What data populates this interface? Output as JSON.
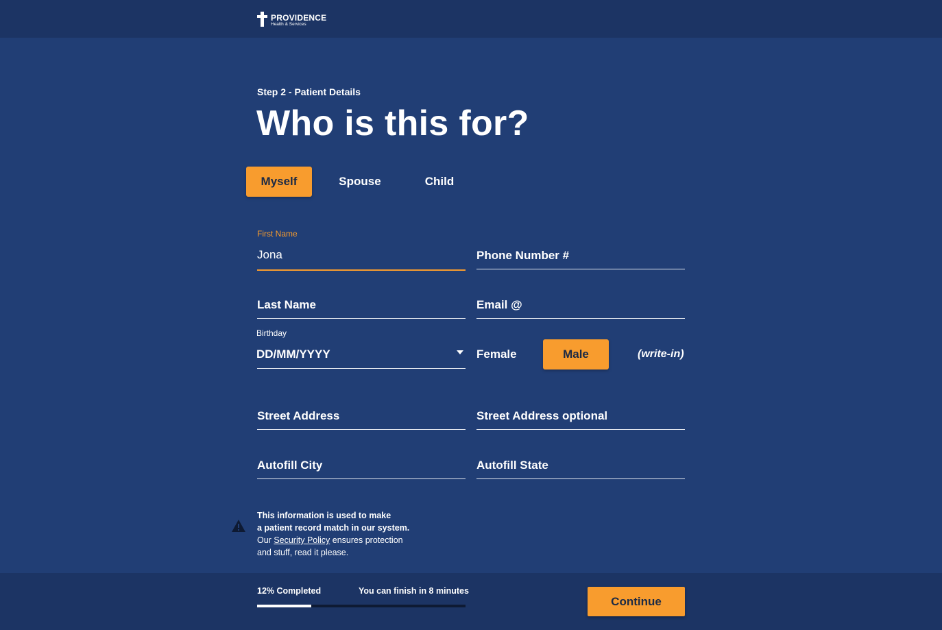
{
  "brand": {
    "name": "PROVIDENCE",
    "tagline": "Health & Services"
  },
  "page": {
    "step": "Step 2 - Patient Details",
    "title": "Who is this for?"
  },
  "who_options": [
    {
      "label": "Myself",
      "selected": true
    },
    {
      "label": "Spouse",
      "selected": false
    },
    {
      "label": "Child",
      "selected": false
    }
  ],
  "form": {
    "first_name": {
      "label": "First Name",
      "value": "Jona"
    },
    "phone": {
      "placeholder": "Phone Number #"
    },
    "last_name": {
      "placeholder": "Last Name"
    },
    "email": {
      "placeholder": "Email @"
    },
    "birthday": {
      "label": "Birthday",
      "placeholder": "DD/MM/YYYY"
    },
    "gender": {
      "options": [
        {
          "label": "Female",
          "selected": false
        },
        {
          "label": "Male",
          "selected": true
        }
      ],
      "write_in": "(write-in)"
    },
    "street": {
      "placeholder": "Street Address"
    },
    "street2": {
      "placeholder": "Street Address optional"
    },
    "city": {
      "placeholder": "Autofill City"
    },
    "state": {
      "placeholder": "Autofill State"
    }
  },
  "info": {
    "line1": "This information is used to make",
    "line2": "a patient record match in our system.",
    "prefix": "Our ",
    "link": "Security Policy",
    "suffix": " ensures protection",
    "line4": "and stuff, read it please."
  },
  "footer": {
    "progress_label": "12% Completed",
    "progress_percent": 26,
    "finish_label": "You can finish in 8 minutes",
    "continue_label": "Continue"
  },
  "colors": {
    "background": "#213e75",
    "header": "#1c3464",
    "accent": "#f89c2e"
  }
}
